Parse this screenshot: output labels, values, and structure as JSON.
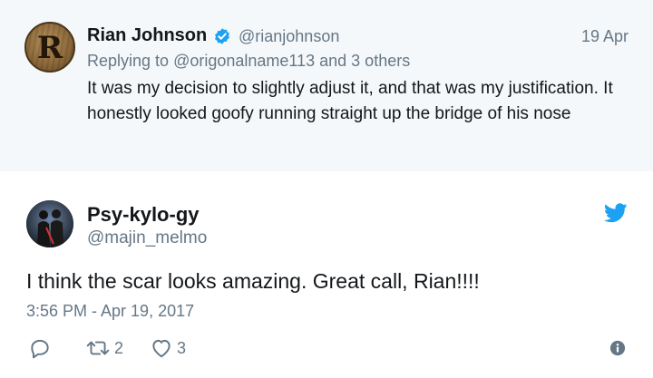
{
  "parent_tweet": {
    "avatar_letter": "R",
    "author_name": "Rian Johnson",
    "verified": true,
    "author_handle": "@rianjohnson",
    "date": "19 Apr",
    "replying_prefix": "Replying to",
    "replying_user": "@origonalname113",
    "replying_suffix": "and 3 others",
    "text": "It was my decision to slightly adjust it, and that was my justification. It honestly looked goofy running straight up the bridge of his nose"
  },
  "tweet": {
    "author_name": "Psy-kylo-gy",
    "author_handle": "@majin_melmo",
    "text": "I think the scar looks amazing. Great call, Rian!!!!",
    "timestamp": "3:56 PM - Apr 19, 2017",
    "actions": {
      "reply_icon": "speech-bubble-icon",
      "retweet_icon": "retweet-icon",
      "retweet_count": "2",
      "like_icon": "heart-icon",
      "like_count": "3",
      "info_icon": "info-icon"
    }
  },
  "colors": {
    "twitter_blue": "#1da1f2",
    "secondary_text": "#657786",
    "primary_text": "#14171a",
    "parent_background": "#f5f8fa"
  }
}
